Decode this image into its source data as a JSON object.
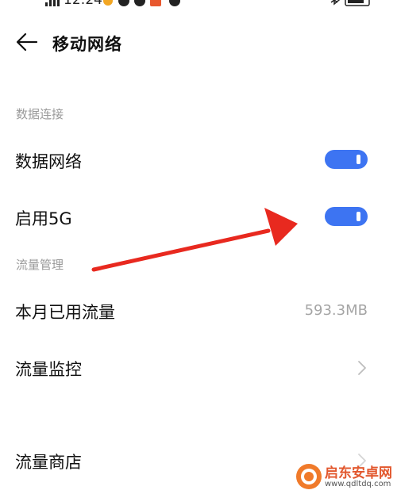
{
  "status_bar": {
    "time": "12:24"
  },
  "header": {
    "title": "移动网络",
    "back_icon": "arrow-left-icon"
  },
  "sections": {
    "data_connection": {
      "title": "数据连接",
      "items": [
        {
          "label": "数据网络",
          "control": "toggle",
          "on": true
        },
        {
          "label": "启用5G",
          "control": "toggle",
          "on": true
        }
      ]
    },
    "traffic_management": {
      "title": "流量管理",
      "items": [
        {
          "label": "本月已用流量",
          "value": "593.3MB"
        },
        {
          "label": "流量监控",
          "control": "chevron-right-icon"
        },
        {
          "label": "流量商店",
          "control": "chevron-right-icon"
        }
      ]
    }
  },
  "colors": {
    "toggle_on": "#3d74f2",
    "annotation_arrow": "#e8291f",
    "section_header": "#9a9a9a",
    "secondary_text": "#a5a5a5"
  },
  "watermark": {
    "name": "启东安卓网",
    "url": "www.qdltdq.com"
  }
}
